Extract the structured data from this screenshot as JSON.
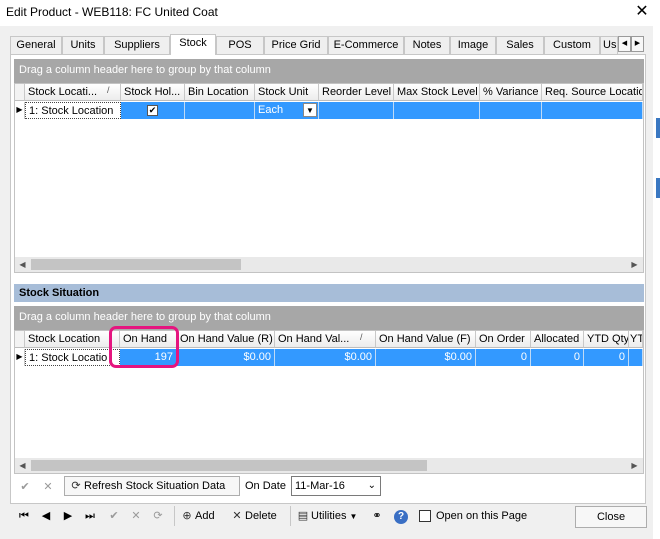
{
  "window": {
    "title": "Edit Product - WEB118: FC United Coat"
  },
  "tabs": [
    {
      "label": "General"
    },
    {
      "label": "Units"
    },
    {
      "label": "Suppliers"
    },
    {
      "label": "Stock"
    },
    {
      "label": "POS"
    },
    {
      "label": "Price Grid"
    },
    {
      "label": "E-Commerce"
    },
    {
      "label": "Notes"
    },
    {
      "label": "Image"
    },
    {
      "label": "Sales"
    },
    {
      "label": "Custom"
    },
    {
      "label": "Us"
    }
  ],
  "tab_scroll": {
    "left": "◀",
    "right": "▶"
  },
  "stock_grid": {
    "group_hint": "Drag a column header here to group by that column",
    "columns": [
      "Stock Locati...",
      "/",
      "Stock Hol...",
      "Bin Location",
      "Stock Unit",
      "Reorder Level",
      "Max Stock Level",
      "% Variance",
      "Req. Source Locatio"
    ],
    "row": {
      "location": "1: Stock Location",
      "stock_unit": "Each",
      "checked": "✔"
    }
  },
  "stock_situation": {
    "title": "Stock Situation",
    "group_hint": "Drag a column header here to group by that column",
    "columns": [
      "Stock Location",
      "On Hand",
      "On Hand Value (R)",
      "On Hand Val...",
      "/",
      "On Hand Value (F)",
      "On Order",
      "Allocated",
      "YTD Qty",
      "YTD"
    ],
    "row": {
      "location": "1: Stock Locatio",
      "on_hand": "197",
      "value_r": "$0.00",
      "value_x": "$0.00",
      "value_f": "$0.00",
      "on_order": "0",
      "allocated": "0",
      "ytd_qty": "0"
    }
  },
  "situation_toolbar": {
    "refresh_label": "Refresh Stock Situation Data",
    "on_date_label": "On Date",
    "on_date_value": "11-Mar-16"
  },
  "bottom_toolbar": {
    "add_label": "Add",
    "delete_label": "Delete",
    "utilities_label": "Utilities",
    "open_on_page_label": "Open on this Page",
    "close_label": "Close"
  },
  "colors": {
    "selection": "#3399ff",
    "highlight": "#e5157f",
    "section_header": "#a7bdd8"
  }
}
